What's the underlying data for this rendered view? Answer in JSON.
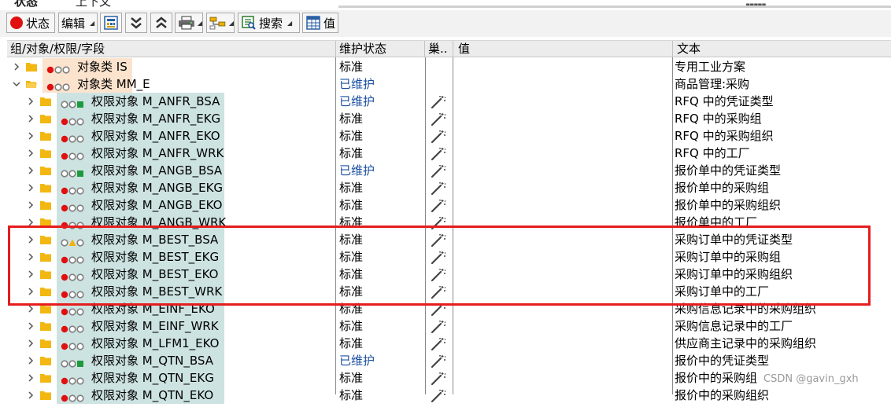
{
  "toolbar": {
    "buttons": [
      {
        "key": "status",
        "label": "状态",
        "icon": "stoplight-red-icon",
        "dropdown": false
      },
      {
        "key": "edit",
        "label": "编辑",
        "icon": "",
        "dropdown": true
      },
      {
        "key": "calc",
        "label": "",
        "icon": "calculator-icon",
        "dropdown": false
      },
      {
        "key": "expand",
        "label": "",
        "icon": "expand-all-icon",
        "dropdown": false
      },
      {
        "key": "collapse",
        "label": "",
        "icon": "collapse-all-icon",
        "dropdown": false
      },
      {
        "key": "print",
        "label": "",
        "icon": "print-icon",
        "dropdown": true
      },
      {
        "key": "tree",
        "label": "",
        "icon": "tree-layout-icon",
        "dropdown": true
      },
      {
        "key": "search",
        "label": "搜索",
        "icon": "search-icon",
        "dropdown": true
      },
      {
        "key": "value",
        "label": "值",
        "icon": "table-icon",
        "dropdown": false
      }
    ]
  },
  "columns": {
    "tree": "组/对象/权限/字段",
    "status": "维护状态",
    "field": "巢..",
    "value": "值",
    "text": "文本"
  },
  "rows": [
    {
      "level": 0,
      "expanded": false,
      "name": "对象类 IS",
      "status": "标准",
      "maintained": false,
      "lights": "red-gray-gray",
      "wand": false,
      "text": "专用工业方案"
    },
    {
      "level": 0,
      "expanded": true,
      "name": "对象类 MM_E",
      "status": "已维护",
      "maintained": true,
      "lights": "red-gray-gray",
      "wand": false,
      "text": "商品管理:采购"
    },
    {
      "level": 1,
      "expanded": false,
      "name": "权限对象 M_ANFR_BSA",
      "status": "已维护",
      "maintained": true,
      "lights": "gray-gray-green",
      "wand": true,
      "text": "RFQ 中的凭证类型"
    },
    {
      "level": 1,
      "expanded": false,
      "name": "权限对象 M_ANFR_EKG",
      "status": "标准",
      "maintained": false,
      "lights": "red-gray-gray",
      "wand": true,
      "text": "RFQ 中的采购组"
    },
    {
      "level": 1,
      "expanded": false,
      "name": "权限对象 M_ANFR_EKO",
      "status": "标准",
      "maintained": false,
      "lights": "red-gray-gray",
      "wand": true,
      "text": "RFQ 中的采购组织"
    },
    {
      "level": 1,
      "expanded": false,
      "name": "权限对象 M_ANFR_WRK",
      "status": "标准",
      "maintained": false,
      "lights": "red-gray-gray",
      "wand": true,
      "text": "RFQ 中的工厂"
    },
    {
      "level": 1,
      "expanded": false,
      "name": "权限对象 M_ANGB_BSA",
      "status": "已维护",
      "maintained": true,
      "lights": "gray-gray-green",
      "wand": true,
      "text": "报价单中的凭证类型"
    },
    {
      "level": 1,
      "expanded": false,
      "name": "权限对象 M_ANGB_EKG",
      "status": "标准",
      "maintained": false,
      "lights": "red-gray-gray",
      "wand": true,
      "text": "报价单中的采购组"
    },
    {
      "level": 1,
      "expanded": false,
      "name": "权限对象 M_ANGB_EKO",
      "status": "标准",
      "maintained": false,
      "lights": "red-gray-gray",
      "wand": true,
      "text": "报价单中的采购组织"
    },
    {
      "level": 1,
      "expanded": false,
      "name": "权限对象 M_ANGB_WRK",
      "status": "标准",
      "maintained": false,
      "lights": "red-gray-gray",
      "wand": true,
      "text": "报价单中的工厂"
    },
    {
      "level": 1,
      "expanded": false,
      "name": "权限对象 M_BEST_BSA",
      "status": "标准",
      "maintained": false,
      "lights": "gray-yellow-gray",
      "wand": true,
      "text": "采购订单中的凭证类型"
    },
    {
      "level": 1,
      "expanded": false,
      "name": "权限对象 M_BEST_EKG",
      "status": "标准",
      "maintained": false,
      "lights": "red-gray-gray",
      "wand": true,
      "text": "采购订单中的采购组"
    },
    {
      "level": 1,
      "expanded": false,
      "name": "权限对象 M_BEST_EKO",
      "status": "标准",
      "maintained": false,
      "lights": "red-gray-gray",
      "wand": true,
      "text": "采购订单中的采购组织"
    },
    {
      "level": 1,
      "expanded": false,
      "name": "权限对象 M_BEST_WRK",
      "status": "标准",
      "maintained": false,
      "lights": "red-gray-gray",
      "wand": true,
      "text": "采购订单中的工厂"
    },
    {
      "level": 1,
      "expanded": false,
      "name": "权限对象 M_EINF_EKO",
      "status": "标准",
      "maintained": false,
      "lights": "red-gray-gray",
      "wand": true,
      "text": "采购信息记录中的采购组织"
    },
    {
      "level": 1,
      "expanded": false,
      "name": "权限对象 M_EINF_WRK",
      "status": "标准",
      "maintained": false,
      "lights": "red-gray-gray",
      "wand": true,
      "text": "采购信息记录中的工厂"
    },
    {
      "level": 1,
      "expanded": false,
      "name": "权限对象 M_LFM1_EKO",
      "status": "标准",
      "maintained": false,
      "lights": "red-gray-gray",
      "wand": true,
      "text": "供应商主记录中的采购组织"
    },
    {
      "level": 1,
      "expanded": false,
      "name": "权限对象 M_QTN_BSA",
      "status": "已维护",
      "maintained": true,
      "lights": "gray-gray-green",
      "wand": true,
      "text": "报价中的凭证类型"
    },
    {
      "level": 1,
      "expanded": false,
      "name": "权限对象 M_QTN_EKG",
      "status": "标准",
      "maintained": false,
      "lights": "red-gray-gray",
      "wand": true,
      "text": "报价中的采购组"
    },
    {
      "level": 1,
      "expanded": false,
      "name": "权限对象 M_QTN_EKO",
      "status": "标准",
      "maintained": false,
      "lights": "red-gray-gray",
      "wand": true,
      "text": "报价中的采购组织"
    }
  ],
  "topbar": {
    "clipped_left": "状态",
    "clipped_right": "上下文"
  },
  "watermark": "CSDN @gavin_gxh",
  "colors": {
    "highlight": "#e51d1d",
    "maintained_text": "#1a4fa0",
    "folder": "#f3b711",
    "object_selection": "#cde3e2",
    "class_selection": "#fbe3cd",
    "light_red": "#e01010",
    "light_green": "#1e9a3c",
    "light_yellow": "#f2b20c",
    "light_gray": "#7f7f7f"
  }
}
